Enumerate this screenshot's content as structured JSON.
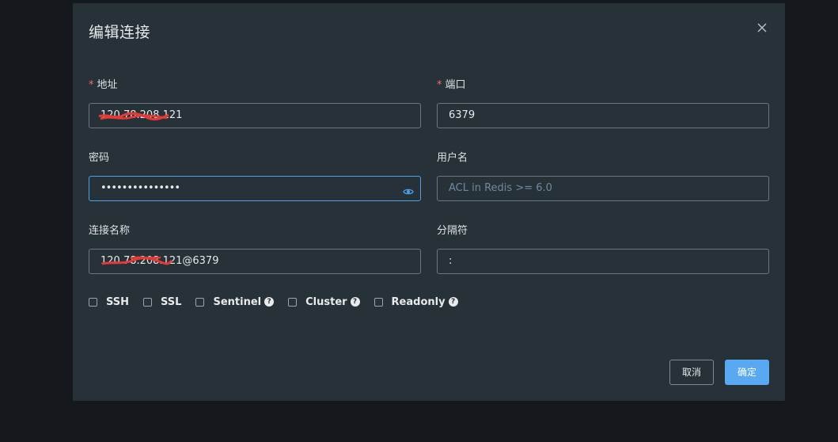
{
  "dialog": {
    "title": "编辑连接",
    "close_icon": "close-icon"
  },
  "form": {
    "address": {
      "label": "地址",
      "required_mark": "*",
      "value": "120.78.208.121"
    },
    "port": {
      "label": "端口",
      "required_mark": "*",
      "value": "6379"
    },
    "password": {
      "label": "密码",
      "value": "•••••••••••••••",
      "icon": "eye-icon"
    },
    "username": {
      "label": "用户名",
      "placeholder": "ACL in Redis >= 6.0"
    },
    "connection_name": {
      "label": "连接名称",
      "value": "120.78.208.121@6379"
    },
    "separator": {
      "label": "分隔符",
      "value": ":"
    }
  },
  "options": [
    {
      "label": "SSH",
      "help": false
    },
    {
      "label": "SSL",
      "help": false
    },
    {
      "label": "Sentinel",
      "help": true
    },
    {
      "label": "Cluster",
      "help": true
    },
    {
      "label": "Readonly",
      "help": true
    }
  ],
  "help_glyph": "?",
  "buttons": {
    "cancel": "取消",
    "ok": "确定"
  },
  "colors": {
    "dialog_bg": "#263238",
    "page_bg": "#15191d",
    "accent": "#59a8f2",
    "required": "#f56c6c",
    "redaction": "#e53935"
  }
}
